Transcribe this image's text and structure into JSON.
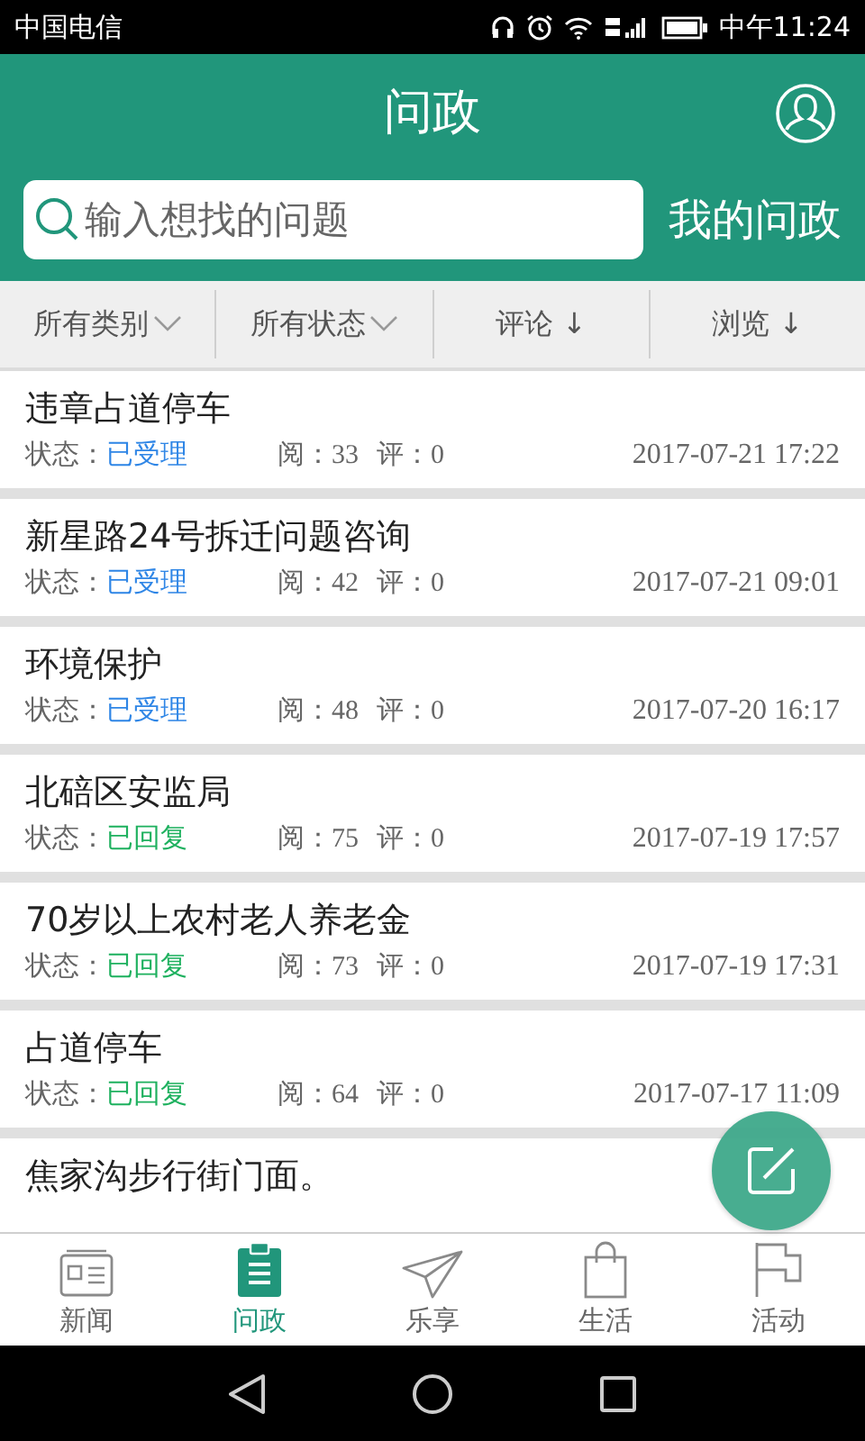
{
  "status_bar": {
    "carrier": "中国电信",
    "time": "中午11:24"
  },
  "header": {
    "title": "问政",
    "search": {
      "placeholder": "输入想找的问题"
    },
    "my_link": "我的问政"
  },
  "filters": [
    {
      "label": "所有类别",
      "kind": "dropdown"
    },
    {
      "label": "所有状态",
      "kind": "dropdown"
    },
    {
      "label": "评论 ↓",
      "kind": "sort"
    },
    {
      "label": "浏览 ↓",
      "kind": "sort"
    }
  ],
  "issues": [
    {
      "title": "违章占道停车",
      "status_label": "状态：",
      "status": "已受理",
      "color": "#2f86e6",
      "reads": "阅：33",
      "comments": "评：0",
      "time": "2017-07-21 17:22"
    },
    {
      "title": "新星路24号拆迁问题咨询",
      "status_label": "状态：",
      "status": "已受理",
      "color": "#2f86e6",
      "reads": "阅：42",
      "comments": "评：0",
      "time": "2017-07-21 09:01"
    },
    {
      "title": "环境保护",
      "status_label": "状态：",
      "status": "已受理",
      "color": "#2f86e6",
      "reads": "阅：48",
      "comments": "评：0",
      "time": "2017-07-20 16:17"
    },
    {
      "title": "北碚区安监局",
      "status_label": "状态：",
      "status": "已回复",
      "color": "#1fb15f",
      "reads": "阅：75",
      "comments": "评：0",
      "time": "2017-07-19 17:57"
    },
    {
      "title": "70岁以上农村老人养老金",
      "status_label": "状态：",
      "status": "已回复",
      "color": "#1fb15f",
      "reads": "阅：73",
      "comments": "评：0",
      "time": "2017-07-19 17:31"
    },
    {
      "title": "占道停车",
      "status_label": "状态：",
      "status": "已回复",
      "color": "#1fb15f",
      "reads": "阅：64",
      "comments": "评：0",
      "time": "2017-07-17 11:09"
    },
    {
      "title": "焦家沟步行街门面。"
    }
  ],
  "tabs": [
    {
      "label": "新闻",
      "selected": false
    },
    {
      "label": "问政",
      "selected": true
    },
    {
      "label": "乐享",
      "selected": false
    },
    {
      "label": "生活",
      "selected": false
    },
    {
      "label": "活动",
      "selected": false
    }
  ]
}
